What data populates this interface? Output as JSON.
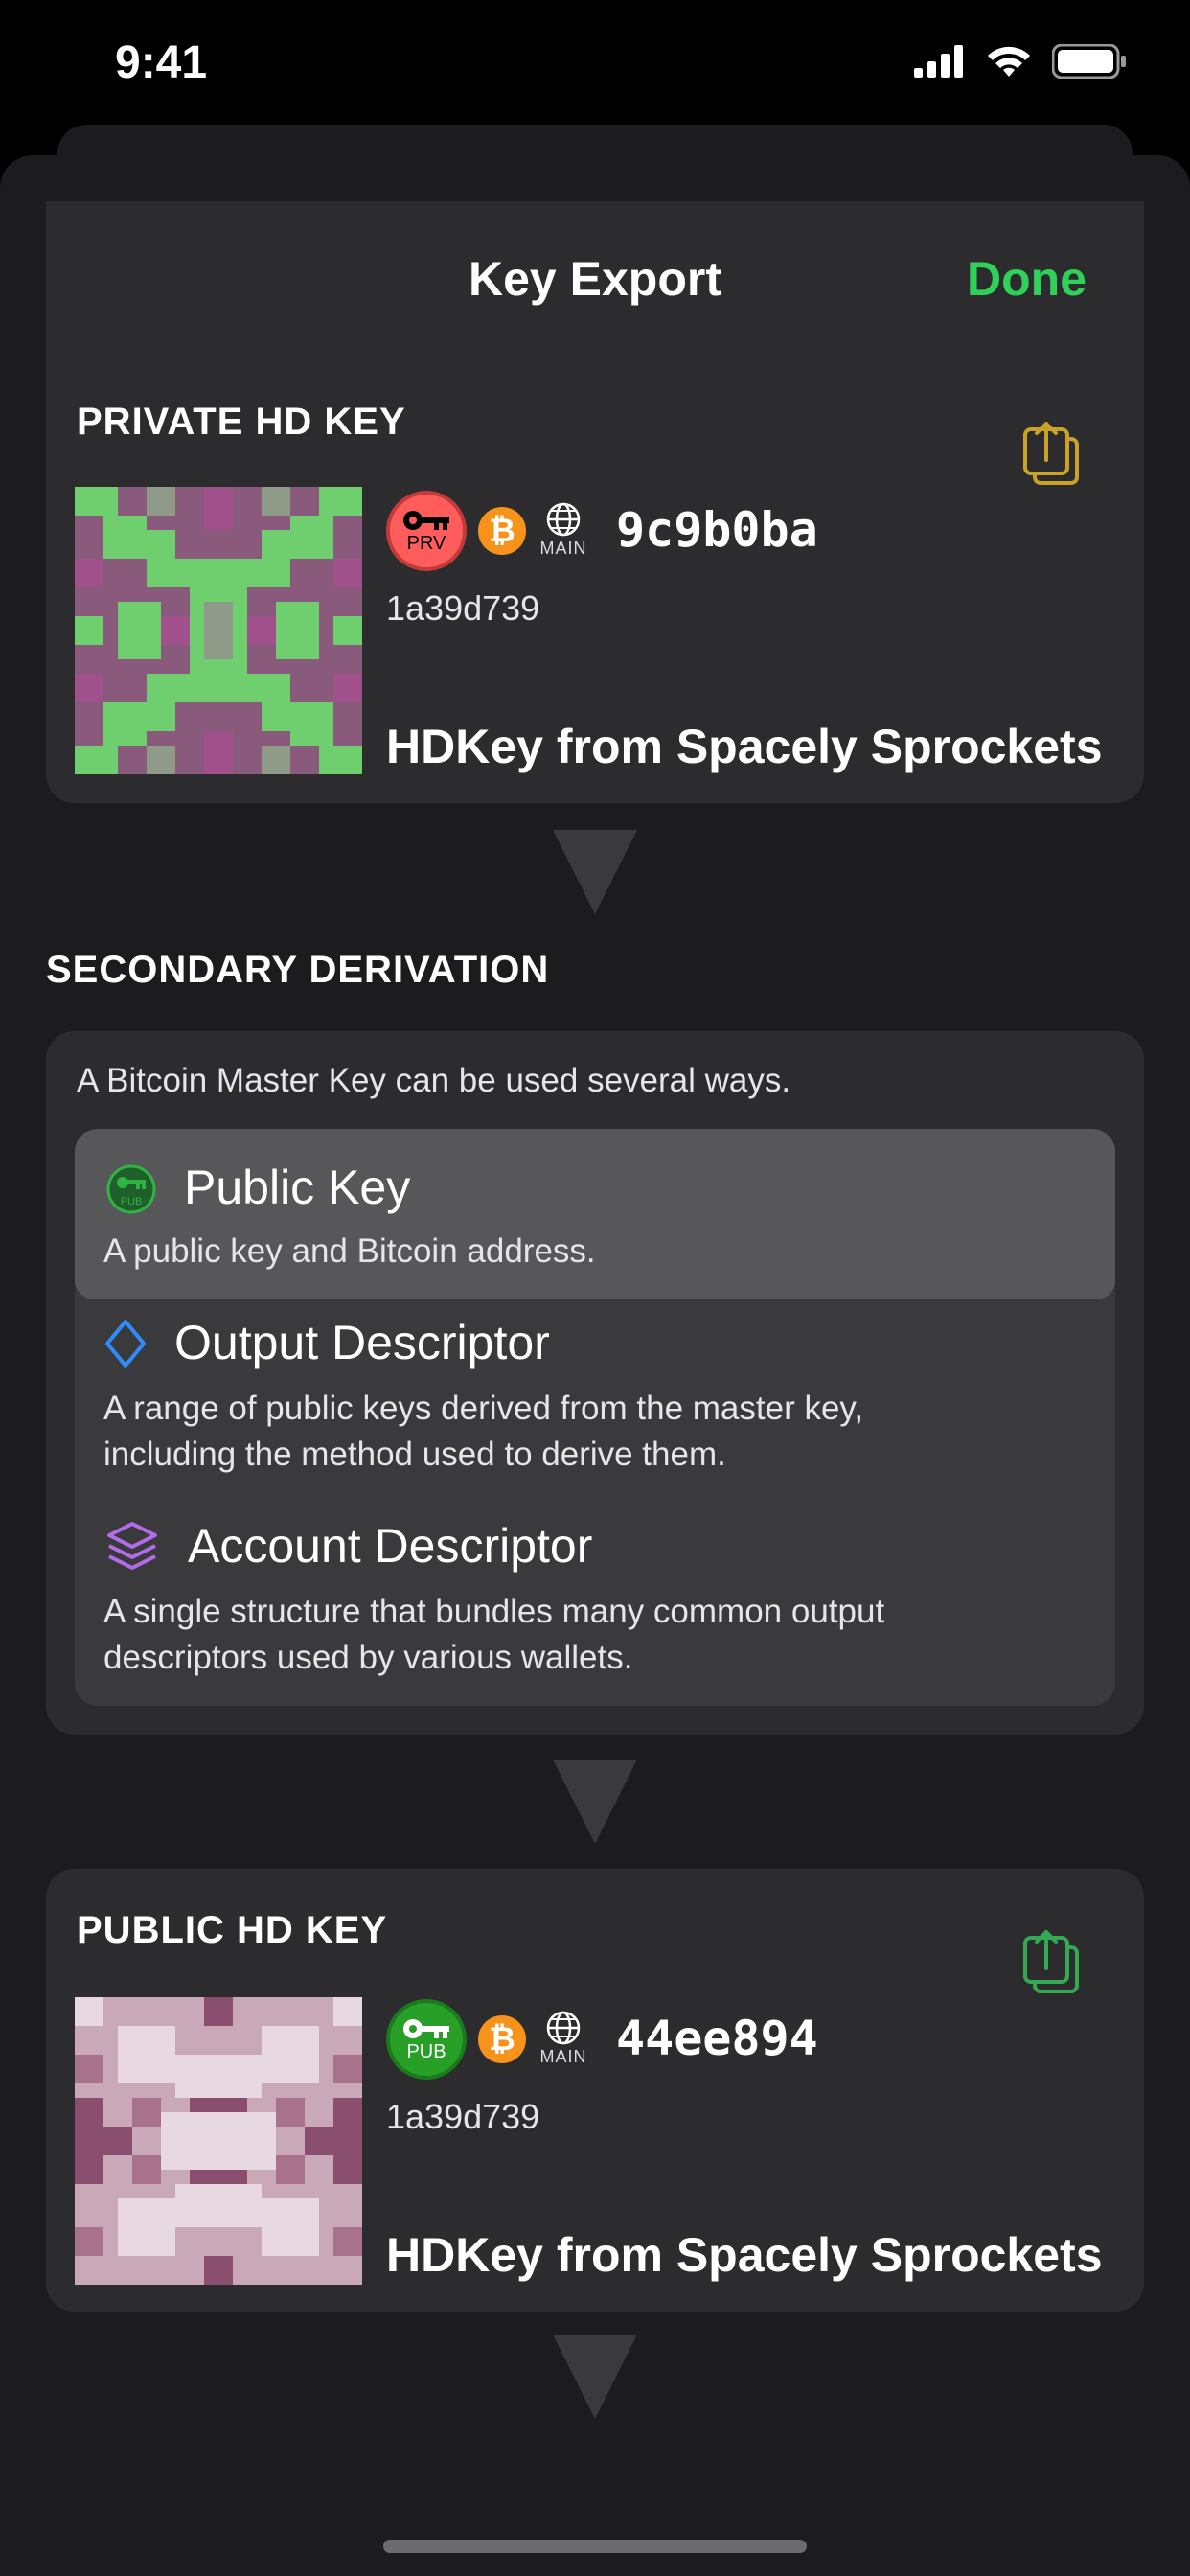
{
  "status": {
    "time": "9:41"
  },
  "nav": {
    "title": "Key Export",
    "done": "Done"
  },
  "private_key": {
    "section": "PRIVATE HD KEY",
    "badge": "PRV",
    "network": "MAIN",
    "fingerprint": "9c9b0ba",
    "parent": "1a39d739",
    "name": "HDKey from Spacely Sprockets"
  },
  "derivation": {
    "section": "SECONDARY DERIVATION",
    "intro": "A Bitcoin Master Key can be used several ways.",
    "options": [
      {
        "title": "Public Key",
        "desc": "A public key and Bitcoin address.",
        "icon": "pub-key-icon"
      },
      {
        "title": "Output Descriptor",
        "desc_line1": "A range of public keys derived from the master key,",
        "desc_line2": "including the method used to derive them.",
        "icon": "diamond-icon"
      },
      {
        "title": "Account Descriptor",
        "desc_line1": "A single structure that bundles many common output",
        "desc_line2": "descriptors used by various wallets.",
        "icon": "stack-icon"
      }
    ]
  },
  "public_key": {
    "section": "PUBLIC HD KEY",
    "badge": "PUB",
    "network": "MAIN",
    "fingerprint": "44ee894",
    "parent": "1a39d739",
    "name": "HDKey from Spacely Sprockets"
  },
  "colors": {
    "accent_green": "#30d158",
    "share_private": "#c9a227",
    "share_public": "#34a853",
    "prv_badge": "#ff5c5c",
    "pub_badge": "#28a028",
    "bitcoin": "#f7931a"
  }
}
